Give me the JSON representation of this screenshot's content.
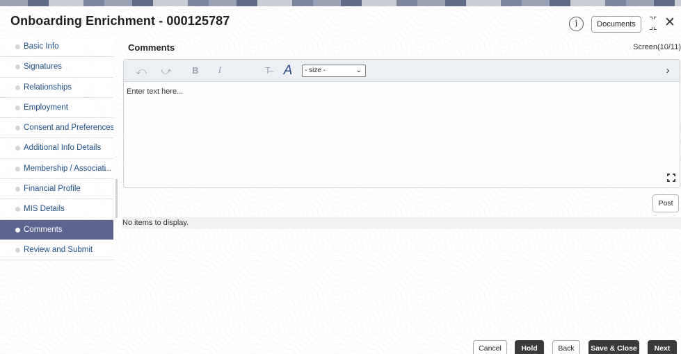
{
  "window": {
    "title": "Onboarding Enrichment - 000125787",
    "info_icon": "info-icon",
    "documents_label": "Documents",
    "minimize_icon": "minimize-icon",
    "close_icon": "close-icon"
  },
  "sidebar": {
    "items": [
      {
        "label": "Basic Info",
        "active": false
      },
      {
        "label": "Signatures",
        "active": false
      },
      {
        "label": "Relationships",
        "active": false
      },
      {
        "label": "Employment",
        "active": false
      },
      {
        "label": "Consent and Preferences",
        "active": false
      },
      {
        "label": "Additional Info Details",
        "active": false
      },
      {
        "label": "Membership / Associati",
        "active": false,
        "ellipsis": "..."
      },
      {
        "label": "Financial Profile",
        "active": false
      },
      {
        "label": "MIS Details",
        "active": false
      },
      {
        "label": "Comments",
        "active": true
      },
      {
        "label": "Review and Submit",
        "active": false
      }
    ],
    "active_color": "#5b6590"
  },
  "main": {
    "section_title": "Comments",
    "screen_counter": "Screen(10/11)",
    "editor": {
      "placeholder": "Enter text here...",
      "size_select_value": "- size -",
      "toolbar_icons": [
        "undo-icon",
        "redo-icon",
        "bold-icon",
        "italic-icon",
        "clear-format-icon",
        "font-icon",
        "chevron-right-icon"
      ],
      "bold_glyph": "B",
      "italic_glyph": "I",
      "font_glyph": "A",
      "strike_glyph": "T̶"
    },
    "post_label": "Post",
    "empty_message": "No items to display."
  },
  "footer": {
    "cancel_label": "Cancel",
    "hold_label": "Hold",
    "back_label": "Back",
    "save_close_label": "Save & Close",
    "next_label": "Next"
  }
}
